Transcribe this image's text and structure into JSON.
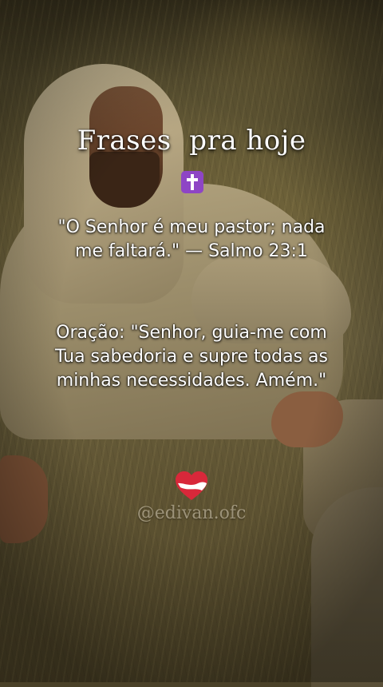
{
  "post": {
    "title": "Frases  pra hoje",
    "cross_icon": "latin-cross-icon",
    "verse_line1": "\"O Senhor é meu pastor; nada",
    "verse_line2": "me faltará.\" — Salmo 23:1",
    "prayer_line1": "Oração: \"Senhor, guia-me com",
    "prayer_line2": "Tua sabedoria e supre todas as",
    "prayer_line3": "minhas necessidades. Amém.\"",
    "heart_icon": "heart-icon",
    "signature": "@edivan.ofc"
  },
  "colors": {
    "text": "#ffffff",
    "cross_badge": "#8e45c5",
    "heart_red": "#d8283a"
  }
}
